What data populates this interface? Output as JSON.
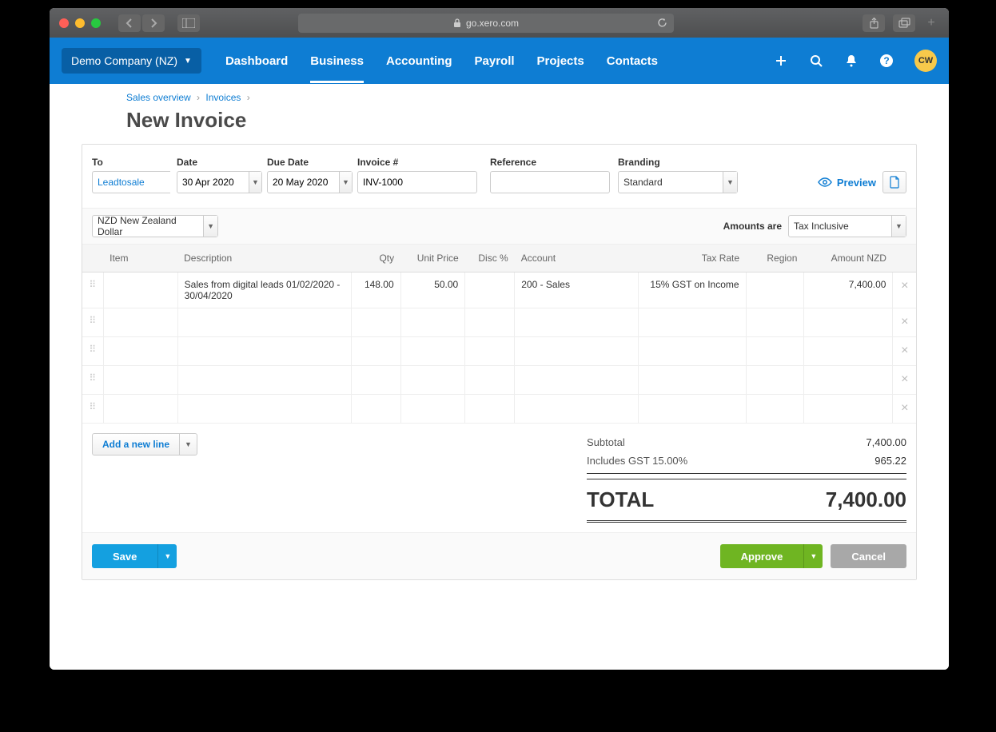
{
  "browser": {
    "url_host": "go.xero.com",
    "lock": "🔒"
  },
  "nav": {
    "company": "Demo Company (NZ)",
    "items": [
      "Dashboard",
      "Business",
      "Accounting",
      "Payroll",
      "Projects",
      "Contacts"
    ],
    "active_index": 1,
    "avatar": "CW"
  },
  "breadcrumbs": {
    "items": [
      "Sales overview",
      "Invoices"
    ]
  },
  "page_title": "New Invoice",
  "form": {
    "to_label": "To",
    "to_value": "Leadtosale",
    "date_label": "Date",
    "date_value": "30 Apr 2020",
    "due_date_label": "Due Date",
    "due_date_value": "20 May 2020",
    "invoice_no_label": "Invoice #",
    "invoice_no_value": "INV-1000",
    "reference_label": "Reference",
    "reference_value": "",
    "branding_label": "Branding",
    "branding_value": "Standard",
    "preview_label": "Preview",
    "currency_value": "NZD New Zealand Dollar",
    "amounts_are_label": "Amounts are",
    "amounts_are_value": "Tax Inclusive"
  },
  "table": {
    "headers": {
      "item": "Item",
      "description": "Description",
      "qty": "Qty",
      "unit_price": "Unit Price",
      "disc": "Disc %",
      "account": "Account",
      "tax_rate": "Tax Rate",
      "region": "Region",
      "amount": "Amount NZD"
    },
    "rows": [
      {
        "item": "",
        "description": "Sales from digital leads 01/02/2020 - 30/04/2020",
        "qty": "148.00",
        "unit_price": "50.00",
        "disc": "",
        "account": "200 - Sales",
        "tax_rate": "15% GST on Income",
        "region": "",
        "amount": "7,400.00"
      },
      {
        "item": "",
        "description": "",
        "qty": "",
        "unit_price": "",
        "disc": "",
        "account": "",
        "tax_rate": "",
        "region": "",
        "amount": ""
      },
      {
        "item": "",
        "description": "",
        "qty": "",
        "unit_price": "",
        "disc": "",
        "account": "",
        "tax_rate": "",
        "region": "",
        "amount": ""
      },
      {
        "item": "",
        "description": "",
        "qty": "",
        "unit_price": "",
        "disc": "",
        "account": "",
        "tax_rate": "",
        "region": "",
        "amount": ""
      },
      {
        "item": "",
        "description": "",
        "qty": "",
        "unit_price": "",
        "disc": "",
        "account": "",
        "tax_rate": "",
        "region": "",
        "amount": ""
      }
    ],
    "add_line_label": "Add a new line"
  },
  "totals": {
    "subtotal_label": "Subtotal",
    "subtotal_value": "7,400.00",
    "gst_label": "Includes GST 15.00%",
    "gst_value": "965.22",
    "total_label": "TOTAL",
    "total_value": "7,400.00"
  },
  "footer": {
    "save": "Save",
    "approve": "Approve",
    "cancel": "Cancel"
  }
}
